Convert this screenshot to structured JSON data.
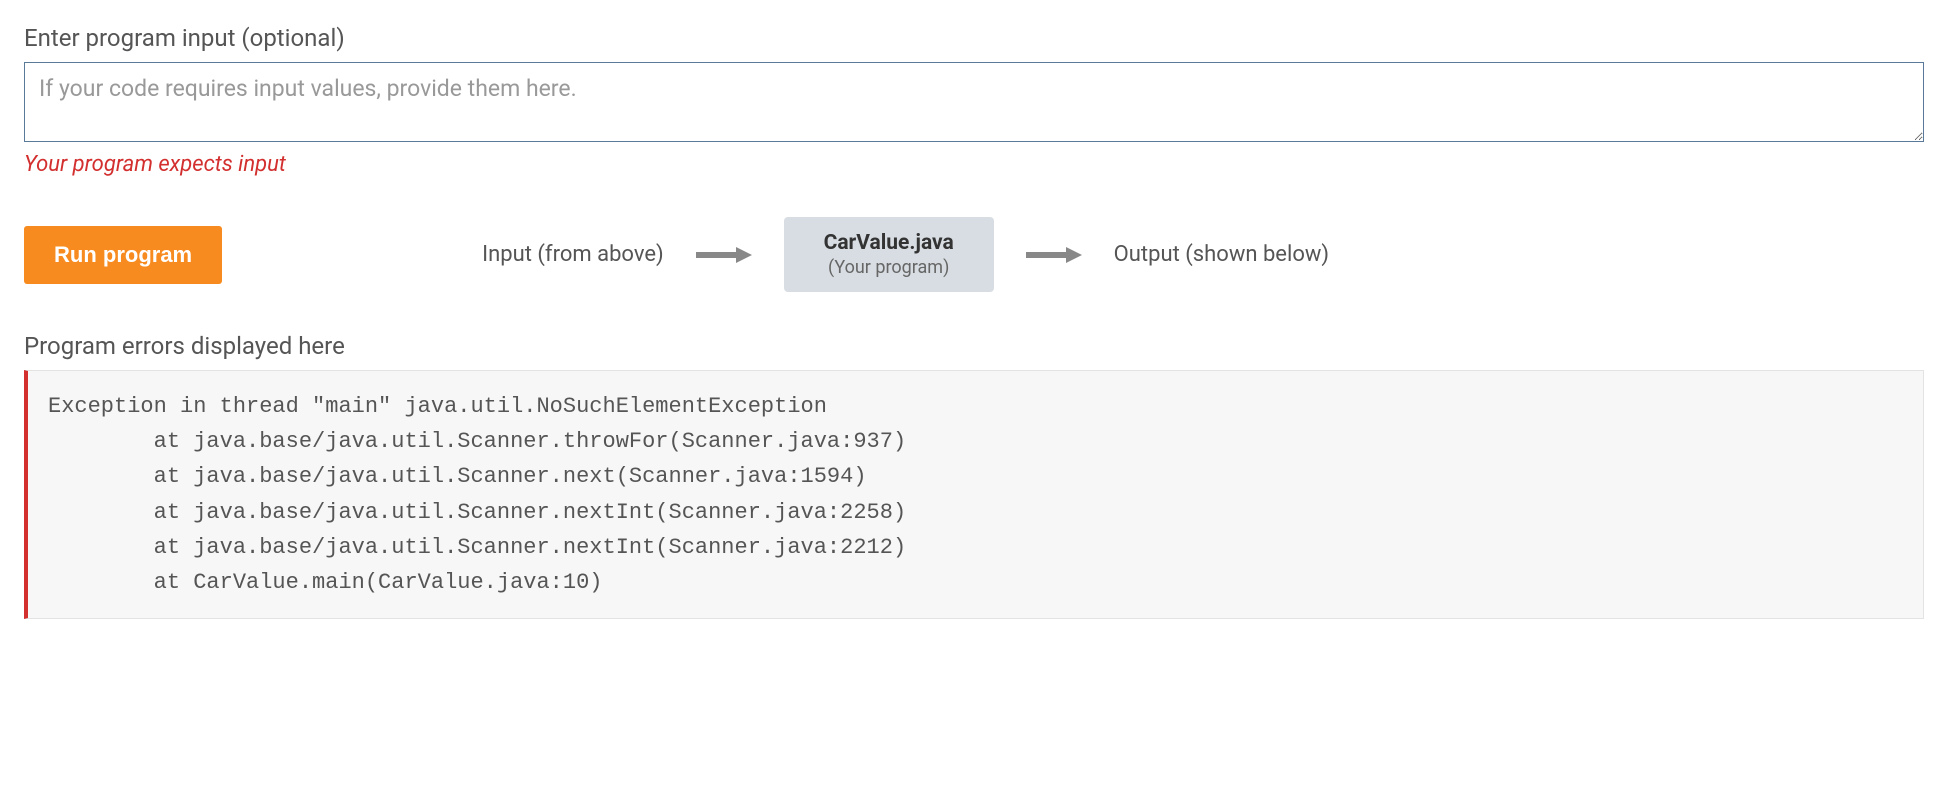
{
  "input_section": {
    "label": "Enter program input (optional)",
    "placeholder": "If your code requires input values, provide them here.",
    "value": "",
    "hint": "Your program expects input"
  },
  "run": {
    "button_label": "Run program",
    "flow_input_label": "Input (from above)",
    "program_name": "CarValue.java",
    "program_sub": "(Your program)",
    "flow_output_label": "Output (shown below)"
  },
  "errors": {
    "label": "Program errors displayed here",
    "text": "Exception in thread \"main\" java.util.NoSuchElementException\n        at java.base/java.util.Scanner.throwFor(Scanner.java:937)\n        at java.base/java.util.Scanner.next(Scanner.java:1594)\n        at java.base/java.util.Scanner.nextInt(Scanner.java:2258)\n        at java.base/java.util.Scanner.nextInt(Scanner.java:2212)\n        at CarValue.main(CarValue.java:10)"
  }
}
